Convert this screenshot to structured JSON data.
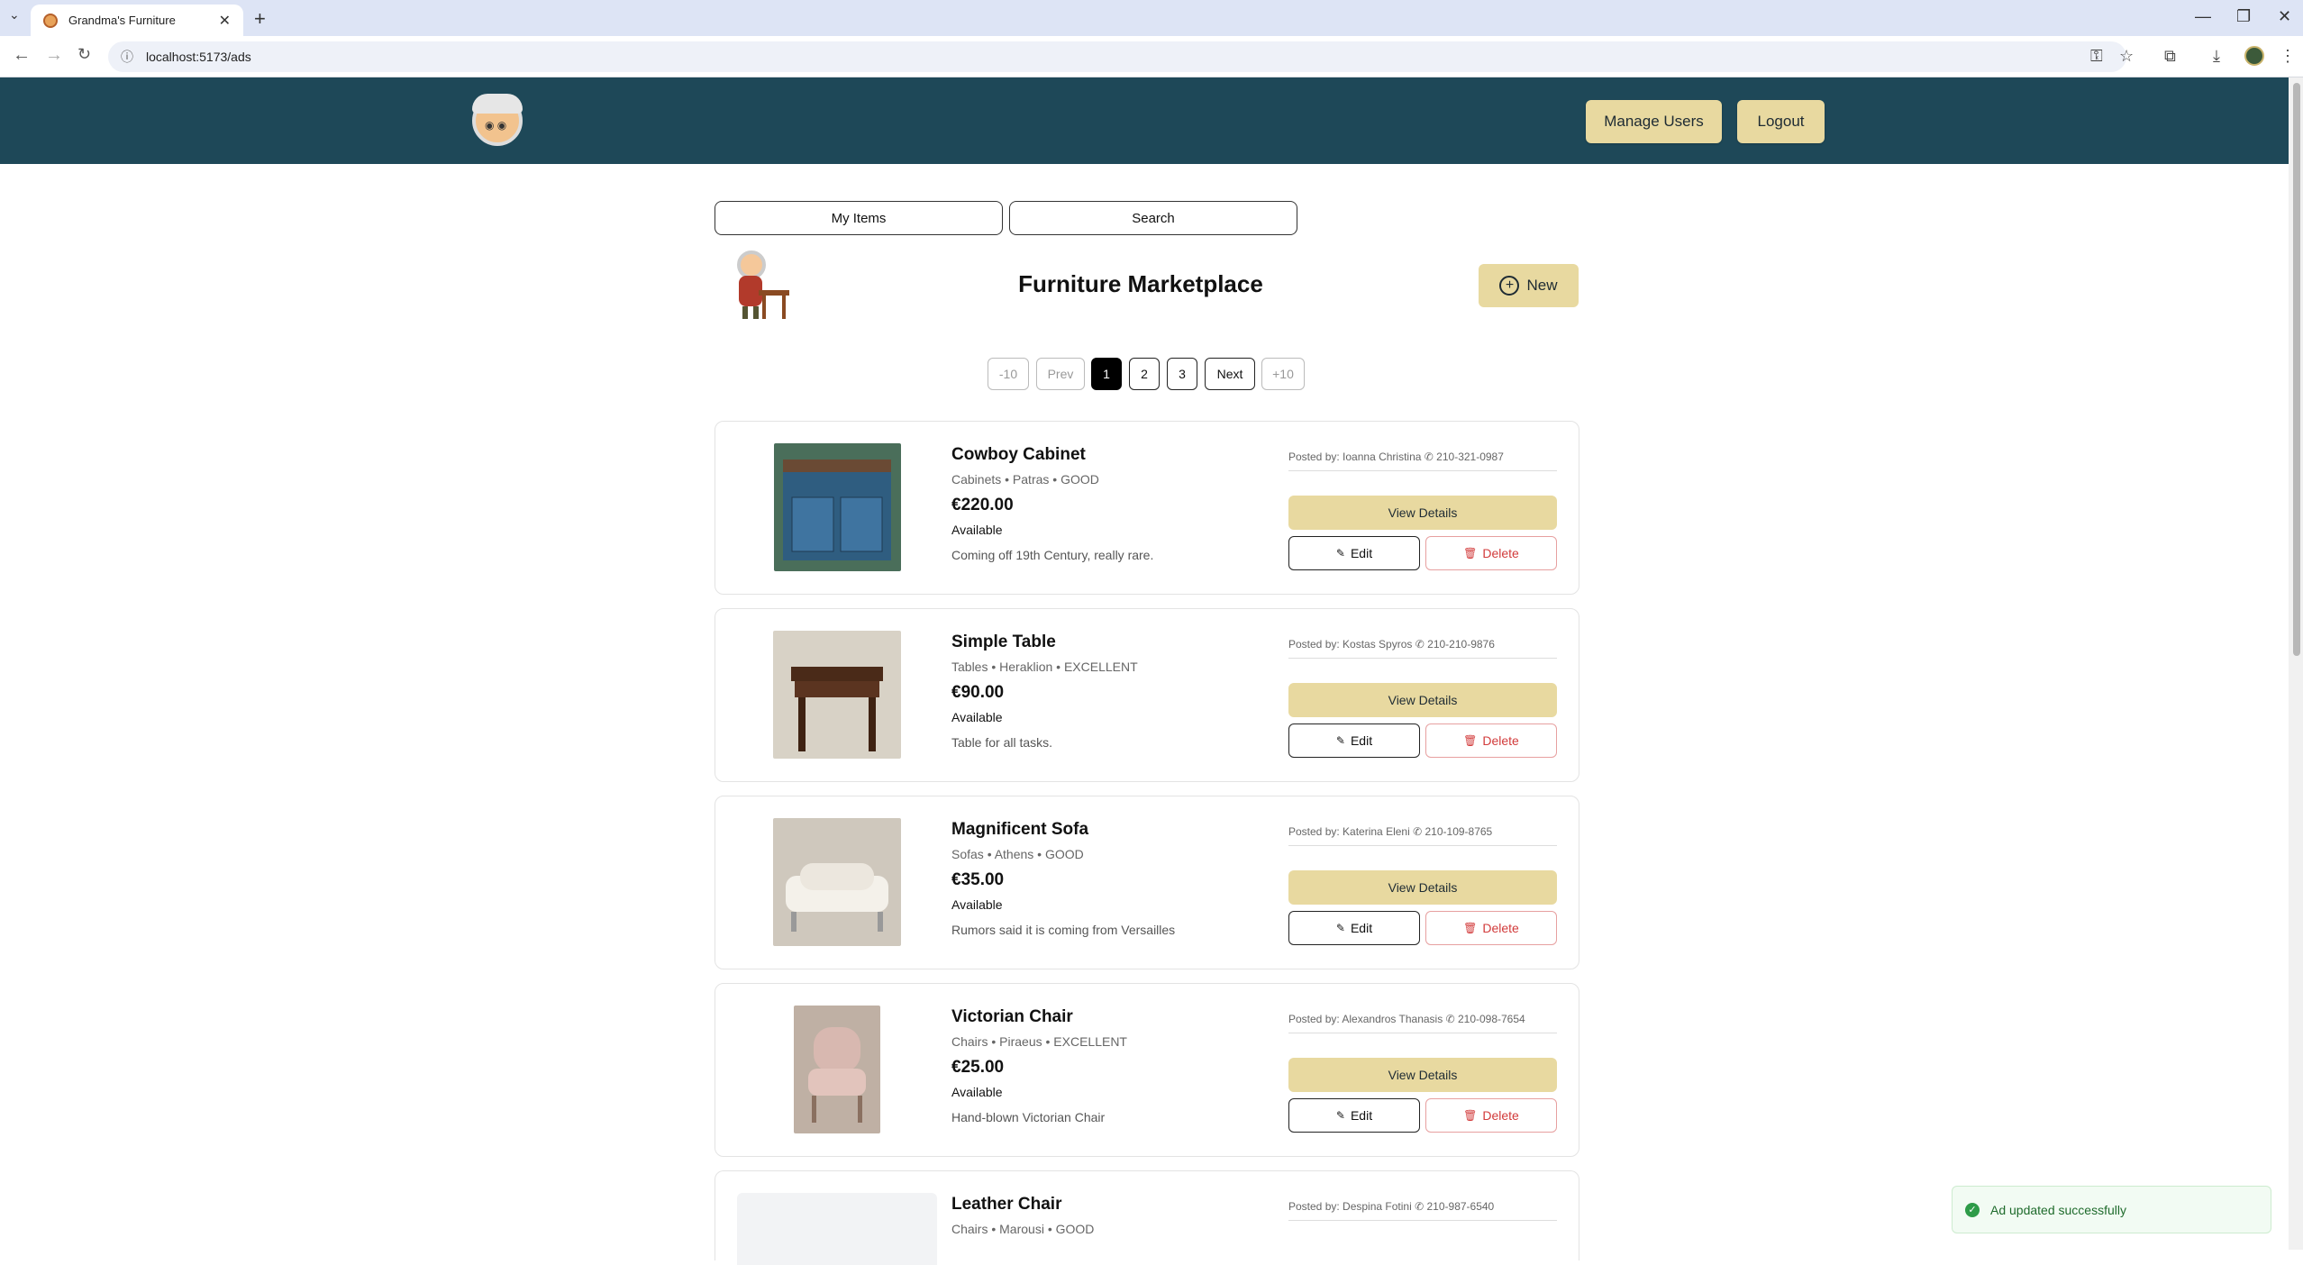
{
  "browser": {
    "tab_title": "Grandma's Furniture",
    "url": "localhost:5173/ads",
    "new_tab_icon": "plus-icon",
    "menu_icon": "chevron-down-icon"
  },
  "header": {
    "logo_icon": "grandma-logo-icon",
    "manage_users_label": "Manage Users",
    "logout_label": "Logout",
    "bg_color": "#1e4858",
    "button_color": "#e8d9a0"
  },
  "tabs": {
    "my_items_label": "My Items",
    "search_label": "Search"
  },
  "main": {
    "title": "Furniture Marketplace",
    "new_label": "New"
  },
  "pagination": {
    "minus10": "-10",
    "prev": "Prev",
    "pages": [
      "1",
      "2",
      "3"
    ],
    "current": "1",
    "next": "Next",
    "plus10": "+10"
  },
  "listings": [
    {
      "title": "Cowboy Cabinet",
      "meta": "Cabinets • Patras • GOOD",
      "price": "€220.00",
      "availability": "Available",
      "description": "Coming off 19th Century, really rare.",
      "posted_by": "Posted by: Ioanna Christina",
      "phone": "210-321-0987",
      "view_label": "View Details",
      "edit_label": "Edit",
      "delete_label": "Delete"
    },
    {
      "title": "Simple Table",
      "meta": "Tables • Heraklion • EXCELLENT",
      "price": "€90.00",
      "availability": "Available",
      "description": "Table for all tasks.",
      "posted_by": "Posted by: Kostas Spyros",
      "phone": "210-210-9876",
      "view_label": "View Details",
      "edit_label": "Edit",
      "delete_label": "Delete"
    },
    {
      "title": "Magnificent Sofa",
      "meta": "Sofas • Athens • GOOD",
      "price": "€35.00",
      "availability": "Available",
      "description": "Rumors said it is coming from Versailles",
      "posted_by": "Posted by: Katerina Eleni",
      "phone": "210-109-8765",
      "view_label": "View Details",
      "edit_label": "Edit",
      "delete_label": "Delete"
    },
    {
      "title": "Victorian Chair",
      "meta": "Chairs • Piraeus • EXCELLENT",
      "price": "€25.00",
      "availability": "Available",
      "description": "Hand-blown Victorian Chair",
      "posted_by": "Posted by: Alexandros Thanasis",
      "phone": "210-098-7654",
      "view_label": "View Details",
      "edit_label": "Edit",
      "delete_label": "Delete"
    },
    {
      "title": "Leather Chair",
      "meta": "Chairs • Marousi • GOOD",
      "posted_by": "Posted by: Despina Fotini",
      "phone": "210-987-6540"
    }
  ],
  "toast": {
    "message": "Ad updated successfully",
    "icon": "check-circle-icon",
    "color": "#2e9b48"
  }
}
